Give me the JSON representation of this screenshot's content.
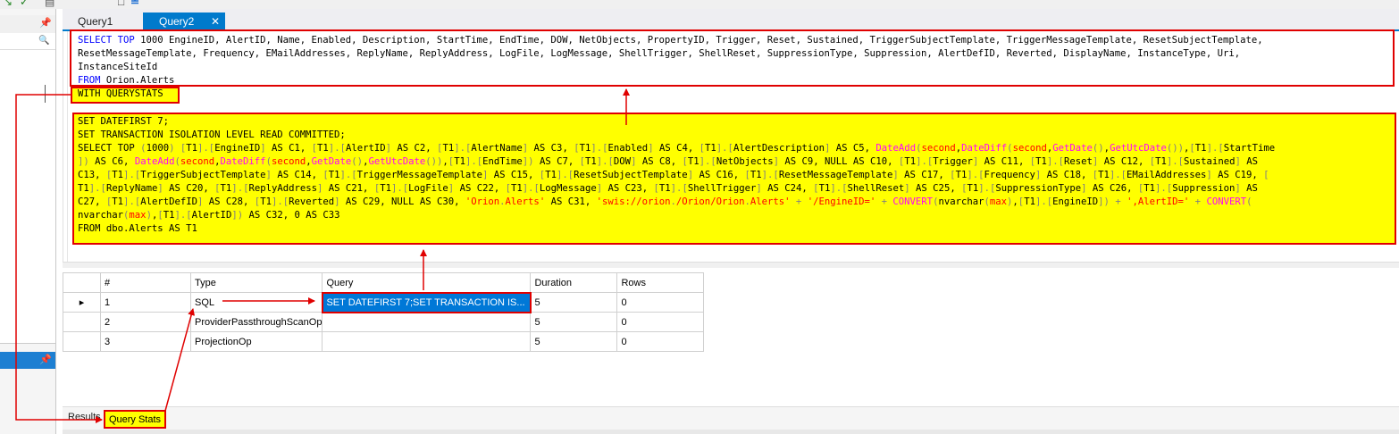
{
  "toolbar": {
    "icons": [
      "arrow-icon",
      "check-icon",
      "save-icon",
      "page-icon",
      "format-icon"
    ]
  },
  "left_pane": {
    "pin1": "⮌",
    "pin2": "⮌",
    "search": "🔎"
  },
  "tabs": [
    {
      "label": "Query1"
    },
    {
      "label": "Query2",
      "close": "✕"
    }
  ],
  "editor": {
    "line1": "SELECT TOP 1000 EngineID, AlertID, Name, Enabled, Description, StartTime, EndTime, DOW, NetObjects, PropertyID, Trigger, Reset, Sustained, TriggerSubjectTemplate, TriggerMessageTemplate, ResetSubjectTemplate,",
    "line2": "ResetMessageTemplate, Frequency, EMailAddresses, ReplyName, ReplyAddress, LogFile, LogMessage, ShellTrigger, ShellReset, SuppressionType, Suppression, AlertDefID, Reverted, DisplayName, InstanceType, Uri,",
    "line3": "InstanceSiteId",
    "line4_kw": "FROM",
    "line4_rest": " Orion.Alerts",
    "with_querystats": "WITH QUERYSTATS"
  },
  "stats_sql": {
    "l1": "SET DATEFIRST 7;",
    "l2": "SET TRANSACTION ISOLATION LEVEL READ COMMITTED;",
    "l3": "SELECT TOP (1000) [T1].[EngineID] AS C1, [T1].[AlertID] AS C2, [T1].[AlertName] AS C3, [T1].[Enabled] AS C4, [T1].[AlertDescription] AS C5, DateAdd(second,DateDiff(second,GetDate(),GetUtcDate()),[T1].[StartTime",
    "l4": "]) AS C6, DateAdd(second,DateDiff(second,GetDate(),GetUtcDate()),[T1].[EndTime]) AS C7, [T1].[DOW] AS C8, [T1].[NetObjects] AS C9, NULL AS C10, [T1].[Trigger] AS C11, [T1].[Reset] AS C12, [T1].[Sustained] AS",
    "l5": "C13, [T1].[TriggerSubjectTemplate] AS C14, [T1].[TriggerMessageTemplate] AS C15, [T1].[ResetSubjectTemplate] AS C16, [T1].[ResetMessageTemplate] AS C17, [T1].[Frequency] AS C18, [T1].[EMailAddresses] AS C19, [",
    "l6": "T1].[ReplyName] AS C20, [T1].[ReplyAddress] AS C21, [T1].[LogFile] AS C22, [T1].[LogMessage] AS C23, [T1].[ShellTrigger] AS C24, [T1].[ShellReset] AS C25, [T1].[SuppressionType] AS C26, [T1].[Suppression] AS",
    "l7": "C27, [T1].[AlertDefID] AS C28, [T1].[Reverted] AS C29, NULL AS C30, 'Orion.Alerts' AS C31, 'swis://orion./Orion/Orion.Alerts' + '/EngineID=' + CONVERT(nvarchar(max),[T1].[EngineID]) + ',AlertID=' + CONVERT(",
    "l8": "nvarchar(max),[T1].[AlertID]) AS C32, 0 AS C33",
    "l9": "FROM dbo.Alerts AS T1"
  },
  "grid": {
    "headers": [
      "#",
      "Type",
      "Query",
      "Duration",
      "Rows"
    ],
    "rows": [
      {
        "num": "1",
        "type": "SQL",
        "query": "SET DATEFIRST 7;SET TRANSACTION IS...",
        "duration": "5",
        "rows": "0"
      },
      {
        "num": "2",
        "type": "ProviderPassthroughScanOp",
        "query": "",
        "duration": "5",
        "rows": "0"
      },
      {
        "num": "3",
        "type": "ProjectionOp",
        "query": "",
        "duration": "5",
        "rows": "0"
      }
    ]
  },
  "bottom_tabs": {
    "results": "Results",
    "query_stats": "Query Stats"
  },
  "colors": {
    "highlight": "#ffff00",
    "annotation": "#e00000",
    "accent": "#007acc"
  }
}
